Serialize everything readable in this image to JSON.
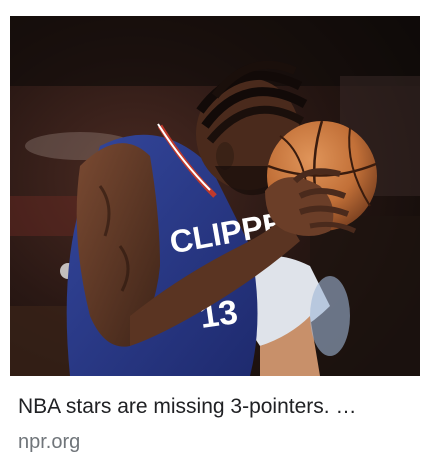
{
  "result": {
    "title": "NBA stars are missing 3-pointers. …",
    "source": "npr.org",
    "image_alt": "Basketball player holding ball to forehead",
    "jersey_text": "CLIPPERS",
    "jersey_number": "13"
  },
  "colors": {
    "jersey": "#2a3a8c",
    "ball": "#c8743a",
    "background": "#1a1210",
    "caption_text": "#202124",
    "source_text": "#70757a"
  }
}
